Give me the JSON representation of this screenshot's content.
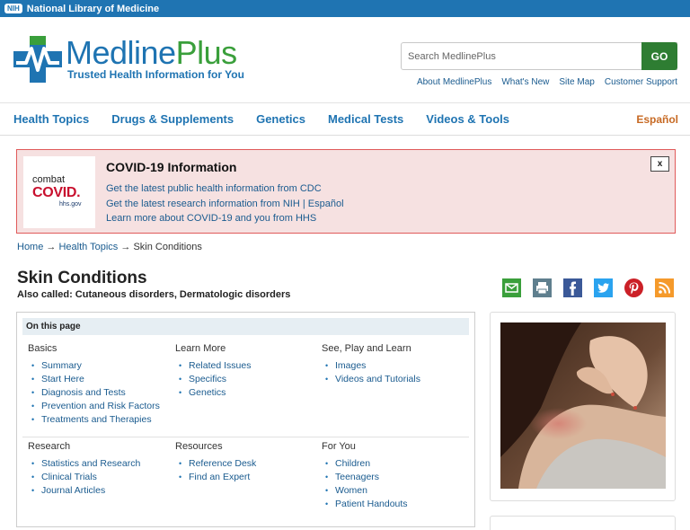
{
  "nih": {
    "badge": "NIH",
    "label": "National Library of Medicine"
  },
  "brand": {
    "name_part1": "Medline",
    "name_part2": "Plus",
    "tagline": "Trusted Health Information for You"
  },
  "search": {
    "placeholder": "Search MedlinePlus",
    "go_label": "GO"
  },
  "utility_links": [
    "About MedlinePlus",
    "What's New",
    "Site Map",
    "Customer Support"
  ],
  "nav": {
    "items": [
      "Health Topics",
      "Drugs & Supplements",
      "Genetics",
      "Medical Tests",
      "Videos & Tools"
    ],
    "espanol": "Español"
  },
  "covid": {
    "logo_line1": "combat",
    "logo_line2": "COVID.",
    "logo_line3": "hhs.gov",
    "title": "COVID-19 Information",
    "links": [
      "Get the latest public health information from CDC",
      "Get the latest research information from NIH",
      "Español",
      "Learn more about COVID-19 and you from HHS"
    ],
    "separator": "|",
    "close": "x"
  },
  "breadcrumb": {
    "home": "Home",
    "health_topics": "Health Topics",
    "current": "Skin Conditions",
    "arrow": "→"
  },
  "page": {
    "title": "Skin Conditions",
    "also_called": "Also called: Cutaneous disorders, Dermatologic disorders"
  },
  "share_icons": [
    "email-icon",
    "print-icon",
    "facebook-icon",
    "twitter-icon",
    "pinterest-icon",
    "rss-icon"
  ],
  "colors": {
    "nih_blue": "#1f74b2",
    "brand_green": "#3a9f3b",
    "go_green": "#2e7d32",
    "espanol": "#c76a24",
    "covid_bg": "#f6e1e1",
    "covid_border": "#e05a5a"
  },
  "toc": {
    "heading": "On this page",
    "basics": {
      "title": "Basics",
      "items": [
        "Summary",
        "Start Here",
        "Diagnosis and Tests",
        "Prevention and Risk Factors",
        "Treatments and Therapies"
      ]
    },
    "learn_more": {
      "title": "Learn More",
      "items": [
        "Related Issues",
        "Specifics",
        "Genetics"
      ]
    },
    "see_play": {
      "title": "See, Play and Learn",
      "items": [
        "Images",
        "Videos and Tutorials"
      ]
    },
    "research": {
      "title": "Research",
      "items": [
        "Statistics and Research",
        "Clinical Trials",
        "Journal Articles"
      ]
    },
    "resources": {
      "title": "Resources",
      "items": [
        "Reference Desk",
        "Find an Expert"
      ]
    },
    "for_you": {
      "title": "For You",
      "items": [
        "Children",
        "Teenagers",
        "Women",
        "Patient Handouts"
      ]
    }
  }
}
